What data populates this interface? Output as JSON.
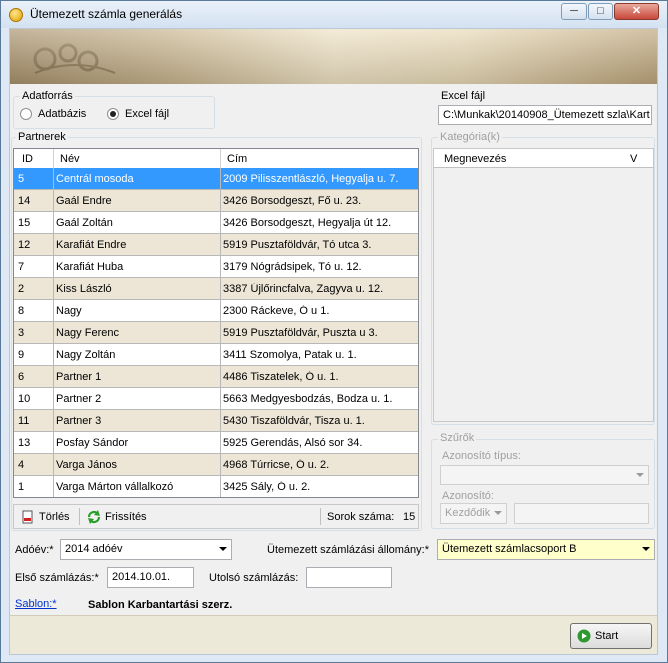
{
  "window": {
    "title": "Ütemezett számla generálás",
    "minimize": "─",
    "maximize": "□",
    "close": "✕"
  },
  "datasource": {
    "legend": "Adatforrás",
    "options": [
      {
        "label": "Adatbázis",
        "selected": false
      },
      {
        "label": "Excel fájl",
        "selected": true
      }
    ]
  },
  "excel": {
    "legend": "Excel fájl",
    "path": "C:\\Munkak\\20140908_Ütemezett szla\\Kart"
  },
  "partners": {
    "legend": "Partnerek",
    "columns": [
      "ID",
      "Név",
      "Cím"
    ],
    "rows": [
      {
        "id": "5",
        "name": "Centrál mosoda",
        "address": "2009 Pilisszentlászló, Hegyalja u. 7.",
        "selected": true
      },
      {
        "id": "14",
        "name": "Gaál Endre",
        "address": "3426 Borsodgeszt, Fő u. 23."
      },
      {
        "id": "15",
        "name": "Gaál Zoltán",
        "address": "3426 Borsodgeszt, Hegyalja út 12."
      },
      {
        "id": "12",
        "name": "Karafiát Endre",
        "address": "5919 Pusztaföldvár, Tó utca 3."
      },
      {
        "id": "7",
        "name": "Karafiát Huba",
        "address": "3179 Nógrádsipek, Tó u. 12."
      },
      {
        "id": "2",
        "name": "Kiss László",
        "address": "3387 Újlőrincfalva, Zagyva u. 12."
      },
      {
        "id": "8",
        "name": "Nagy",
        "address": "2300 Ráckeve, Ó u 1."
      },
      {
        "id": "3",
        "name": "Nagy Ferenc",
        "address": "5919 Pusztaföldvár, Puszta u 3."
      },
      {
        "id": "9",
        "name": "Nagy Zoltán",
        "address": "3411 Szomolya, Patak u. 1."
      },
      {
        "id": "6",
        "name": "Partner 1",
        "address": "4486 Tiszatelek, Ó u. 1."
      },
      {
        "id": "10",
        "name": "Partner 2",
        "address": "5663 Medgyesbodzás, Bodza u. 1."
      },
      {
        "id": "11",
        "name": "Partner 3",
        "address": "5430 Tiszaföldvár, Tisza u. 1."
      },
      {
        "id": "13",
        "name": "Posfay Sándor",
        "address": "5925 Gerendás, Alsó sor 34."
      },
      {
        "id": "4",
        "name": "Varga János",
        "address": "4968 Túrricse, Ó u. 2."
      },
      {
        "id": "1",
        "name": "Varga Márton vállalkozó",
        "address": "3425 Sály, Ó u. 2."
      }
    ],
    "delete_label": "Törlés",
    "refresh_label": "Frissítés",
    "rowcount_label": "Sorok száma:",
    "rowcount_value": "15"
  },
  "categories": {
    "legend": "Kategória(k)",
    "columns": [
      "Megnevezés",
      "V"
    ]
  },
  "filters": {
    "legend": "Szűrők",
    "type_label": "Azonosító típus:",
    "id_label": "Azonosító:",
    "match_value": "Kezdődik"
  },
  "form": {
    "year_label": "Adóév:*",
    "year_value": "2014 adóév",
    "state_label": "Ütemezett számlázási állomány:*",
    "state_value": "Ütemezett számlacsoport B",
    "first_label": "Első számlázás:*",
    "first_value": "2014.10.01.",
    "last_label": "Utolsó számlázás:",
    "last_value": "",
    "template_label": "Sablon:*",
    "template_value": "Sablon Karbantartási szerz."
  },
  "start_label": "Start",
  "colors": {
    "selection": "#3399ff",
    "alt_row": "#ede6d7",
    "highlight_input": "#ffffcc"
  }
}
